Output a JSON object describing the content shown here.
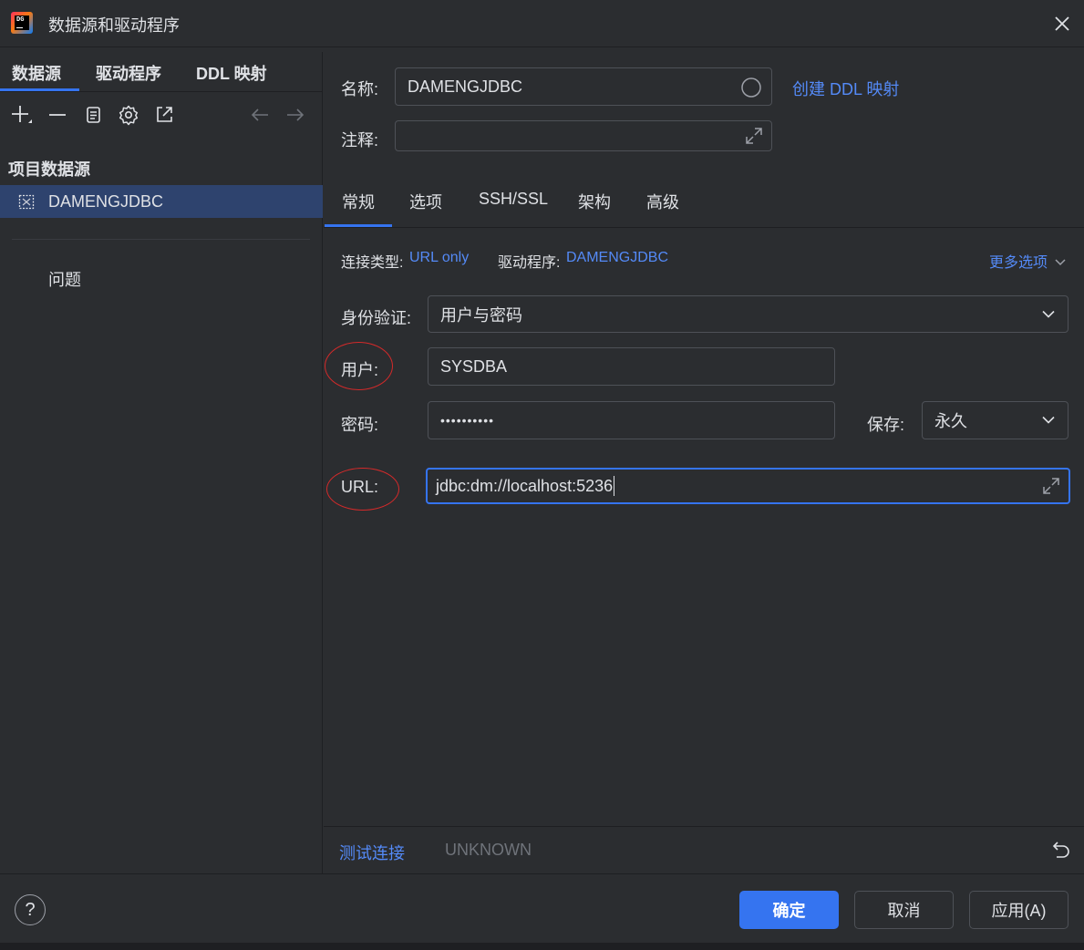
{
  "window": {
    "title": "数据源和驱动程序"
  },
  "left": {
    "tabs": [
      "数据源",
      "驱动程序",
      "DDL 映射"
    ],
    "section_title": "项目数据源",
    "datasource_item": "DAMENGJDBC",
    "problems": "问题"
  },
  "header": {
    "name_label": "名称:",
    "name_value": "DAMENGJDBC",
    "create_ddl_link": "创建 DDL 映射",
    "comment_label": "注释:",
    "comment_value": ""
  },
  "tabs": [
    "常规",
    "选项",
    "SSH/SSL",
    "架构",
    "高级"
  ],
  "info": {
    "conn_type_label": "连接类型:",
    "conn_type_value": "URL only",
    "driver_label": "驱动程序:",
    "driver_value": "DAMENGJDBC",
    "more_options": "更多选项"
  },
  "form": {
    "auth_label": "身份验证:",
    "auth_value": "用户与密码",
    "user_label": "用户:",
    "user_value": "SYSDBA",
    "password_label": "密码:",
    "password_value": "••••••••••",
    "save_label": "保存:",
    "save_value": "永久",
    "url_label": "URL:",
    "url_value": "jdbc:dm://localhost:5236"
  },
  "status": {
    "test_connection": "测试连接",
    "test_result": "UNKNOWN"
  },
  "footer": {
    "help": "?",
    "ok": "确定",
    "cancel": "取消",
    "apply": "应用(A)"
  },
  "colors": {
    "accent": "#3574f0",
    "link": "#548af7",
    "selected_row": "#2e436e",
    "annotation_circle": "#d42a2a"
  }
}
